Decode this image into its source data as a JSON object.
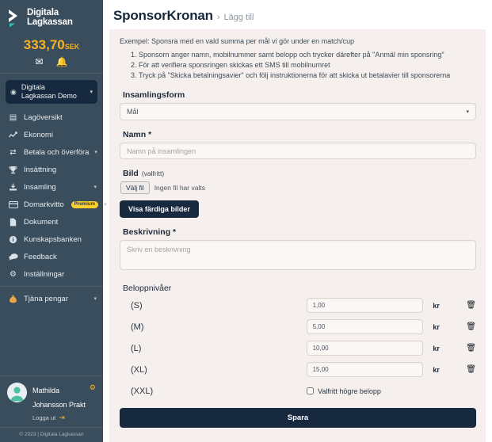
{
  "sidebar": {
    "brand": {
      "line1": "Digitala",
      "line2": "Lagkassan",
      "logo_icon": "chevron-logo-icon"
    },
    "balance": {
      "amount": "333,70",
      "currency": "SEK"
    },
    "quick_icons": [
      {
        "name": "mail-icon",
        "glyph": "✉"
      },
      {
        "name": "bell-icon",
        "glyph": "🔔"
      }
    ],
    "team_selector": {
      "line1": "Digitala",
      "line2": "Lagkassan Demo",
      "icon": "team-badge-icon",
      "caret": "▾"
    },
    "items": [
      {
        "label": "Lagöversikt",
        "icon": "id-card-icon",
        "glyph": "▤",
        "caret": false,
        "badge": null
      },
      {
        "label": "Ekonomi",
        "icon": "chart-line-icon",
        "glyph": "↗",
        "caret": false,
        "badge": null
      },
      {
        "label": "Betala och överföra",
        "icon": "exchange-arrows-icon",
        "glyph": "⇄",
        "caret": true,
        "badge": null
      },
      {
        "label": "Insättning",
        "icon": "trophy-icon",
        "glyph": "♟",
        "caret": false,
        "badge": null
      },
      {
        "label": "Insamling",
        "icon": "download-collect-icon",
        "glyph": "⤓",
        "caret": true,
        "badge": null
      },
      {
        "label": "Domarkvitto",
        "icon": "credit-card-icon",
        "glyph": "▭",
        "caret": true,
        "badge": "Premium"
      },
      {
        "label": "Dokument",
        "icon": "document-icon",
        "glyph": "☰",
        "caret": false,
        "badge": null
      },
      {
        "label": "Kunskapsbanken",
        "icon": "info-circle-icon",
        "glyph": "ⓘ",
        "caret": false,
        "badge": null
      },
      {
        "label": "Feedback",
        "icon": "chat-bubble-icon",
        "glyph": "💬",
        "caret": false,
        "badge": null
      },
      {
        "label": "Inställningar",
        "icon": "gear-icon",
        "glyph": "⚙",
        "caret": false,
        "badge": null
      }
    ],
    "earn": {
      "label": "Tjäna pengar",
      "icon": "money-bag-icon",
      "glyph": "▲",
      "caret": "▾"
    },
    "user": {
      "name_line1": "Mathilda",
      "name_line2": "Johansson Prakt",
      "logout_label": "Logga ut",
      "logout_icon": "logout-arrow-icon",
      "gear_icon": "user-gear-icon",
      "avatar_icon": "avatar-icon"
    },
    "copyright": "© 2023 | Digitala Lagkassan"
  },
  "header": {
    "title": "SponsorKronan",
    "separator": "›",
    "breadcrumb": "Lägg till"
  },
  "content": {
    "example_intro": "Exempel: Sponsra med en vald summa per mål vi gör under en match/cup",
    "steps": [
      "Sponsorn anger namn, mobilnummer samt belopp och trycker därefter på \"Anmäl min sponsring\"",
      "För att verifiera sponsringen skickas ett SMS till mobilnumret",
      "Tryck på \"Skicka betalningsavier\" och följ instruktionerna för att skicka ut betalavier till sponsorerna"
    ],
    "form": {
      "insamlingsform": {
        "label": "Insamlingsform",
        "value": "Mål",
        "options": [
          "Mål"
        ],
        "caret": "▾"
      },
      "namn": {
        "label": "Namn *",
        "value": "",
        "placeholder": "Namn på insamlingen"
      },
      "bild": {
        "label": "Bild",
        "optional": "(valfritt)",
        "choose_label": "Välj fil",
        "no_file_text": "Ingen fil har valts",
        "ready_images_label": "Visa färdiga bilder"
      },
      "beskrivning": {
        "label": "Beskrivning *",
        "value": "",
        "placeholder": "Skriv en beskrivning"
      },
      "levels": {
        "title": "Beloppnivåer",
        "currency_suffix": "kr",
        "delete_icon": "trash-icon",
        "rows": [
          {
            "name": "(S)",
            "value": "1,00"
          },
          {
            "name": "(M)",
            "value": "5,00"
          },
          {
            "name": "(L)",
            "value": "10,00"
          },
          {
            "name": "(XL)",
            "value": "15,00"
          }
        ],
        "xxl": {
          "name": "(XXL)",
          "checkbox_label": "Valfritt högre belopp",
          "checked": false
        }
      },
      "save_label": "Spara"
    }
  },
  "colors": {
    "sidebar_bg": "#3a4d5c",
    "sidebar_dark": "#16293e",
    "accent_yellow": "#f5b321",
    "premium_badge": "#fccf2e",
    "card_bg": "#f5f0ed",
    "title": "#16283c"
  }
}
